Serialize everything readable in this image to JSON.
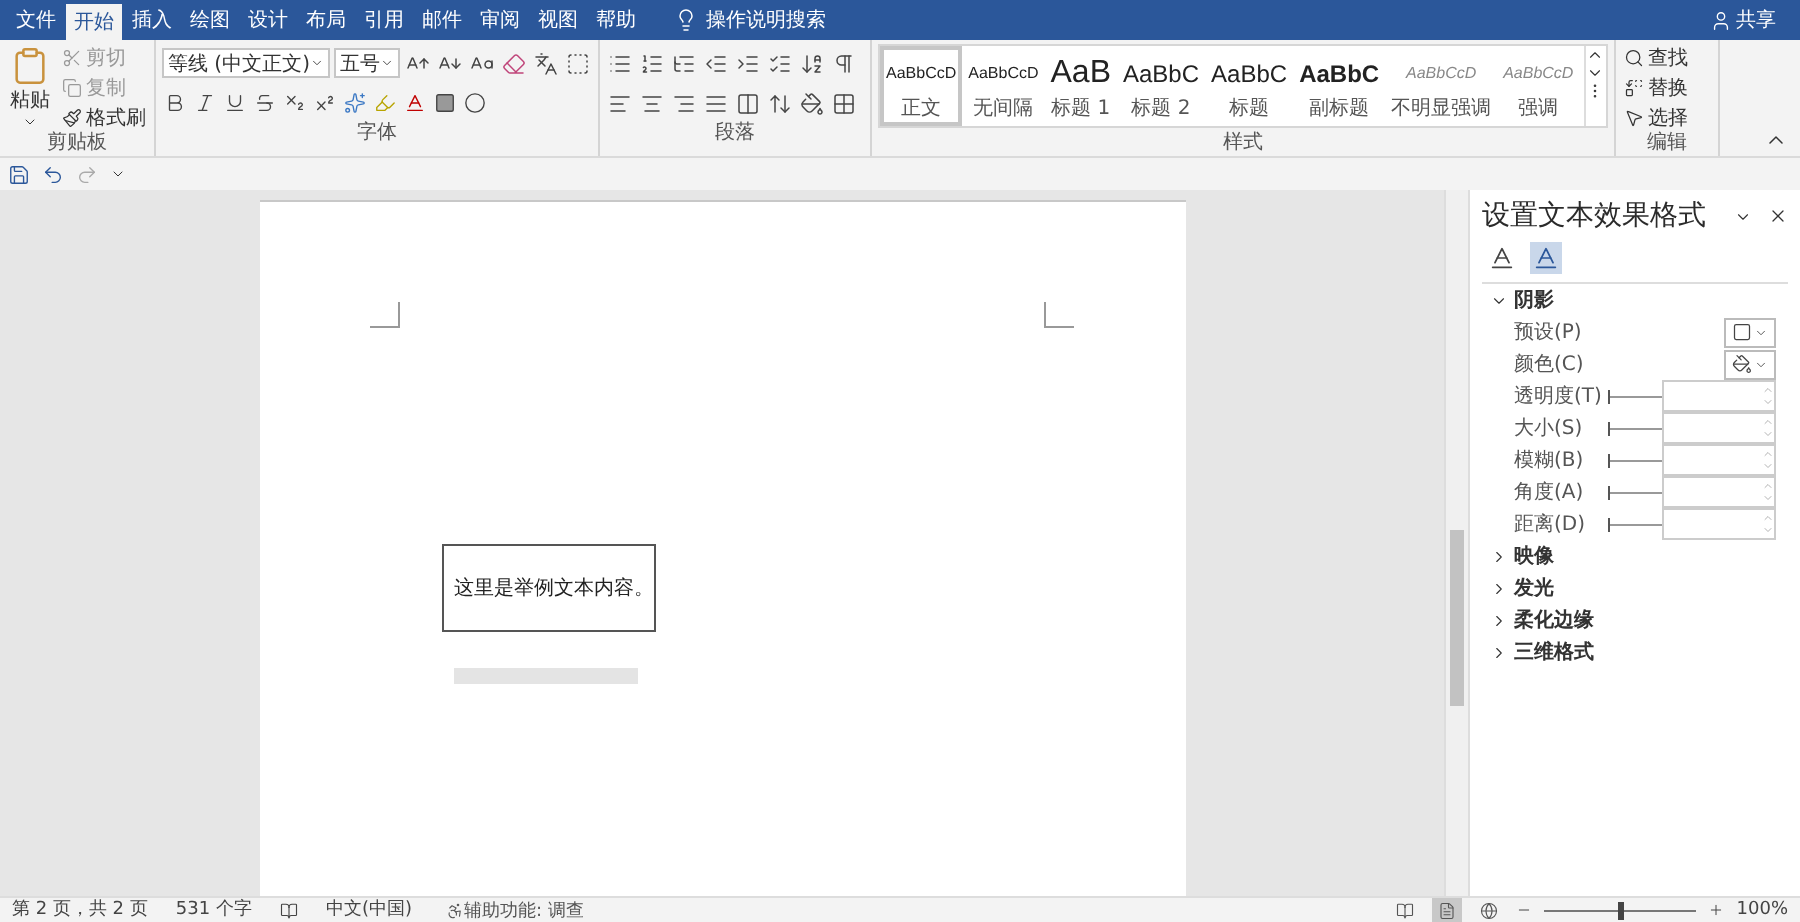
{
  "tabs": [
    {
      "label": "文件",
      "selected": false
    },
    {
      "label": "开始",
      "selected": true
    },
    {
      "label": "插入",
      "selected": false
    },
    {
      "label": "绘图",
      "selected": false
    },
    {
      "label": "设计",
      "selected": false
    },
    {
      "label": "布局",
      "selected": false
    },
    {
      "label": "引用",
      "selected": false
    },
    {
      "label": "邮件",
      "selected": false
    },
    {
      "label": "审阅",
      "selected": false
    },
    {
      "label": "视图",
      "selected": false
    },
    {
      "label": "帮助",
      "selected": false
    }
  ],
  "tell_me": "操作说明搜索",
  "share": "共享",
  "clipboard": {
    "paste": "粘贴",
    "cut": "剪切",
    "copy": "复制",
    "format_painter": "格式刷",
    "label": "剪贴板"
  },
  "font": {
    "name": "等线 (中文正文)",
    "size": "五号",
    "label": "字体"
  },
  "paragraph": {
    "label": "段落"
  },
  "styles": {
    "label": "样式",
    "items": [
      {
        "preview": "AaBbCcD",
        "name": "正文",
        "kind": "normal",
        "selected": true
      },
      {
        "preview": "AaBbCcD",
        "name": "无间隔",
        "kind": "normal",
        "selected": false
      },
      {
        "preview": "AaB",
        "name": "标题 1",
        "kind": "heading1",
        "selected": false
      },
      {
        "preview": "AaBbC",
        "name": "标题 2",
        "kind": "heading2",
        "selected": false
      },
      {
        "preview": "AaBbC",
        "name": "标题",
        "kind": "heading2",
        "selected": false
      },
      {
        "preview": "AaBbC",
        "name": "副标题",
        "kind": "subtitle",
        "selected": false
      },
      {
        "preview": "AaBbCcD",
        "name": "不明显强调",
        "kind": "emphasis",
        "selected": false
      },
      {
        "preview": "AaBbCcD",
        "name": "强调",
        "kind": "emphasis",
        "selected": false
      }
    ]
  },
  "editing": {
    "find": "查找",
    "replace": "替换",
    "select": "选择",
    "label": "编辑"
  },
  "document": {
    "text": "这里是举例文本内容。",
    "reflection": true
  },
  "pane": {
    "title": "设置文本效果格式",
    "tabs": [
      {
        "kind": "fill",
        "selected": false
      },
      {
        "kind": "effects",
        "selected": true
      }
    ],
    "sections": [
      {
        "label": "阴影",
        "expanded": true
      },
      {
        "label": "映像",
        "expanded": false
      },
      {
        "label": "发光",
        "expanded": false
      },
      {
        "label": "柔化边缘",
        "expanded": false
      },
      {
        "label": "三维格式",
        "expanded": false
      }
    ],
    "dropdowns": [
      {
        "label": "预设(P)",
        "kind": "preset"
      },
      {
        "label": "颜色(C)",
        "kind": "color"
      }
    ],
    "sliders": [
      {
        "label": "透明度(T)",
        "level": 0
      },
      {
        "label": "大小(S)",
        "level": 0
      },
      {
        "label": "模糊(B)",
        "level": 0
      },
      {
        "label": "角度(A)",
        "level": 0
      },
      {
        "label": "距离(D)",
        "level": 0
      }
    ]
  },
  "status_bar": {
    "page": "第 2 页，共 2 页",
    "words": "531 个字",
    "language": "中文(中国)",
    "accessibility": "辅助功能: 调查",
    "views": [
      {
        "kind": "read",
        "selected": false
      },
      {
        "kind": "print",
        "selected": true
      },
      {
        "kind": "web",
        "selected": false
      }
    ],
    "zoom": {
      "level": 0.5
    },
    "zoom_text": "100%"
  }
}
